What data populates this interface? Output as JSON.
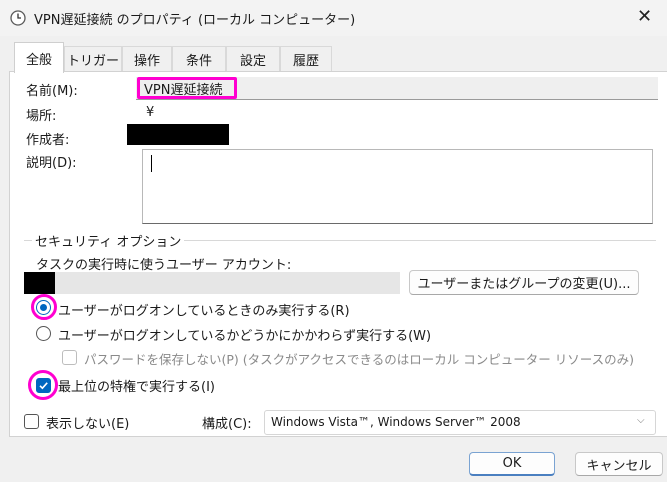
{
  "window": {
    "title": "VPN遅延接続 のプロパティ (ローカル コンピューター)",
    "close_glyph": "✕"
  },
  "tabs": [
    {
      "label": "全般",
      "active": true
    },
    {
      "label": "トリガー"
    },
    {
      "label": "操作"
    },
    {
      "label": "条件"
    },
    {
      "label": "設定"
    },
    {
      "label": "履歴"
    }
  ],
  "general": {
    "name_label": "名前(M):",
    "name_value": "VPN遅延接続",
    "location_label": "場所:",
    "location_value": "¥",
    "author_label": "作成者:",
    "description_label": "説明(D):"
  },
  "security": {
    "group_title": "セキュリティ オプション",
    "account_label": "タスクの実行時に使うユーザー アカウント:",
    "change_button": "ユーザーまたはグループの変更(U)...",
    "radio_logged_on": "ユーザーがログオンしているときのみ実行する(R)",
    "radio_whether": "ユーザーがログオンしているかどうかにかかわらず実行する(W)",
    "no_store_password": "パスワードを保存しない(P) (タスクがアクセスできるのはローカル コンピューター リソースのみ)",
    "highest_privileges": "最上位の特権で実行する(I)",
    "selected_radio": "radio_logged_on",
    "highest_privileges_checked": true
  },
  "bottom": {
    "hidden_label": "表示しない(E)",
    "configure_label": "構成(C):",
    "configure_value": "Windows Vista™, Windows Server™ 2008",
    "ok_button": "OK",
    "cancel_button": "キャンセル"
  },
  "colors": {
    "highlight": "#ff00d0",
    "accent": "#0067c0"
  }
}
